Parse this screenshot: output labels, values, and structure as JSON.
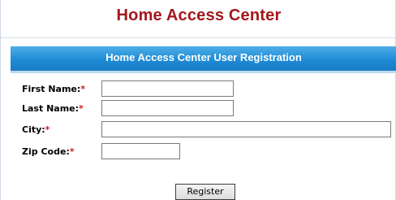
{
  "header": {
    "title": "Home Access Center"
  },
  "banner": {
    "title": "Home Access Center User Registration"
  },
  "form": {
    "required_marker": "*",
    "fields": [
      {
        "label": "First Name:",
        "value": ""
      },
      {
        "label": "Last Name:",
        "value": ""
      },
      {
        "label": "City:",
        "value": ""
      },
      {
        "label": "Zip Code:",
        "value": ""
      }
    ],
    "submit_label": "Register"
  },
  "colors": {
    "title": "#a3171c",
    "banner": "#1f8bd6",
    "required": "#d21b1b"
  }
}
